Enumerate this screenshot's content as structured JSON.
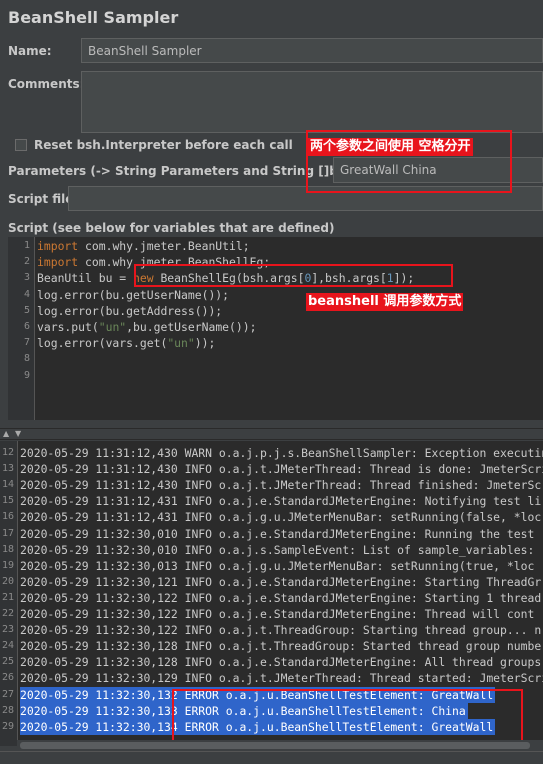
{
  "panel": {
    "title": "BeanShell Sampler"
  },
  "form": {
    "name_label": "Name:",
    "name_value": "BeanShell Sampler",
    "comments_label": "Comments:",
    "reset_label": "Reset bsh.Interpreter before each call",
    "params_label": "Parameters (-> String Parameters and String []bsh.args)",
    "params_value": "GreatWall China",
    "script_file_label": "Script file",
    "script_label": "Script (see below for variables that are defined)"
  },
  "annotations": {
    "params_note": "两个参数之间使用 空格分开",
    "code_note": "beanshell 调用参数方式"
  },
  "script": {
    "line_numbers": [
      "1",
      "2",
      "3",
      "4",
      "5",
      "6",
      "7",
      "8",
      "9"
    ],
    "lines": [
      [
        {
          "t": "import",
          "c": "kw"
        },
        {
          "t": " com.why.jmeter.BeanUtil;"
        }
      ],
      [
        {
          "t": "import",
          "c": "kw"
        },
        {
          "t": " com.why.jmeter.BeanShellEg;"
        }
      ],
      [
        {
          "t": "BeanUtil bu = "
        },
        {
          "t": "new",
          "c": "kw"
        },
        {
          "t": " BeanShellEg(bsh.args["
        },
        {
          "t": "0",
          "c": "num"
        },
        {
          "t": "],bsh.args["
        },
        {
          "t": "1",
          "c": "num"
        },
        {
          "t": "]);"
        }
      ],
      [
        {
          "t": "log.error(bu.getUserName());"
        }
      ],
      [
        {
          "t": "log.error(bu.getAddress());"
        }
      ],
      [
        {
          "t": "vars.put("
        },
        {
          "t": "\"un\"",
          "c": "str"
        },
        {
          "t": ",bu.getUserName());"
        }
      ],
      [
        {
          "t": "log.error(vars.get("
        },
        {
          "t": "\"un\"",
          "c": "str"
        },
        {
          "t": "));"
        }
      ],
      [],
      []
    ]
  },
  "divider": {
    "up_arrow": "▲",
    "down_arrow": "▼"
  },
  "log": {
    "rows": [
      {
        "n": "12",
        "text": "2020-05-29 11:31:12,430 WARN o.a.j.p.j.s.BeanShellSampler: Exception executing",
        "sel": false
      },
      {
        "n": "13",
        "text": "2020-05-29 11:31:12,430 INFO o.a.j.t.JMeterThread: Thread is done: JmeterScri",
        "sel": false
      },
      {
        "n": "14",
        "text": "2020-05-29 11:31:12,430 INFO o.a.j.t.JMeterThread: Thread finished: JmeterScri",
        "sel": false
      },
      {
        "n": "15",
        "text": "2020-05-29 11:31:12,431 INFO o.a.j.e.StandardJMeterEngine: Notifying test li",
        "sel": false
      },
      {
        "n": "16",
        "text": "2020-05-29 11:31:12,431 INFO o.a.j.g.u.JMeterMenuBar: setRunning(false, *loc",
        "sel": false
      },
      {
        "n": "17",
        "text": "2020-05-29 11:32:30,010 INFO o.a.j.e.StandardJMeterEngine: Running the test",
        "sel": false
      },
      {
        "n": "18",
        "text": "2020-05-29 11:32:30,010 INFO o.a.j.s.SampleEvent: List of sample_variables: []",
        "sel": false
      },
      {
        "n": "19",
        "text": "2020-05-29 11:32:30,013 INFO o.a.j.g.u.JMeterMenuBar: setRunning(true, *loc",
        "sel": false
      },
      {
        "n": "20",
        "text": "2020-05-29 11:32:30,121 INFO o.a.j.e.StandardJMeterEngine: Starting ThreadGr",
        "sel": false
      },
      {
        "n": "21",
        "text": "2020-05-29 11:32:30,122 INFO o.a.j.e.StandardJMeterEngine: Starting 1 thread",
        "sel": false
      },
      {
        "n": "22",
        "text": "2020-05-29 11:32:30,122 INFO o.a.j.e.StandardJMeterEngine: Thread will cont",
        "sel": false
      },
      {
        "n": "23",
        "text": "2020-05-29 11:32:30,122 INFO o.a.j.t.ThreadGroup: Starting thread group... n",
        "sel": false
      },
      {
        "n": "24",
        "text": "2020-05-29 11:32:30,128 INFO o.a.j.t.ThreadGroup: Started thread group numbe",
        "sel": false
      },
      {
        "n": "25",
        "text": "2020-05-29 11:32:30,128 INFO o.a.j.e.StandardJMeterEngine: All thread groups",
        "sel": false
      },
      {
        "n": "26",
        "text": "2020-05-29 11:32:30,129 INFO o.a.j.t.JMeterThread: Thread started: JmeterScri",
        "sel": false
      },
      {
        "n": "27",
        "text": "2020-05-29 11:32:30,132 ERROR o.a.j.u.BeanShellTestElement: GreatWall",
        "sel": true
      },
      {
        "n": "28",
        "text": "2020-05-29 11:32:30,133 ERROR o.a.j.u.BeanShellTestElement: China",
        "sel": true
      },
      {
        "n": "29",
        "text": "2020-05-29 11:32:30,134 ERROR o.a.j.u.BeanShellTestElement: GreatWall",
        "sel": true
      }
    ]
  },
  "colors": {
    "annotation_red": "#e8141c",
    "selection_blue": "#2f65ca",
    "keyword": "#cc7832",
    "number": "#6897bb",
    "string": "#6a8759"
  }
}
